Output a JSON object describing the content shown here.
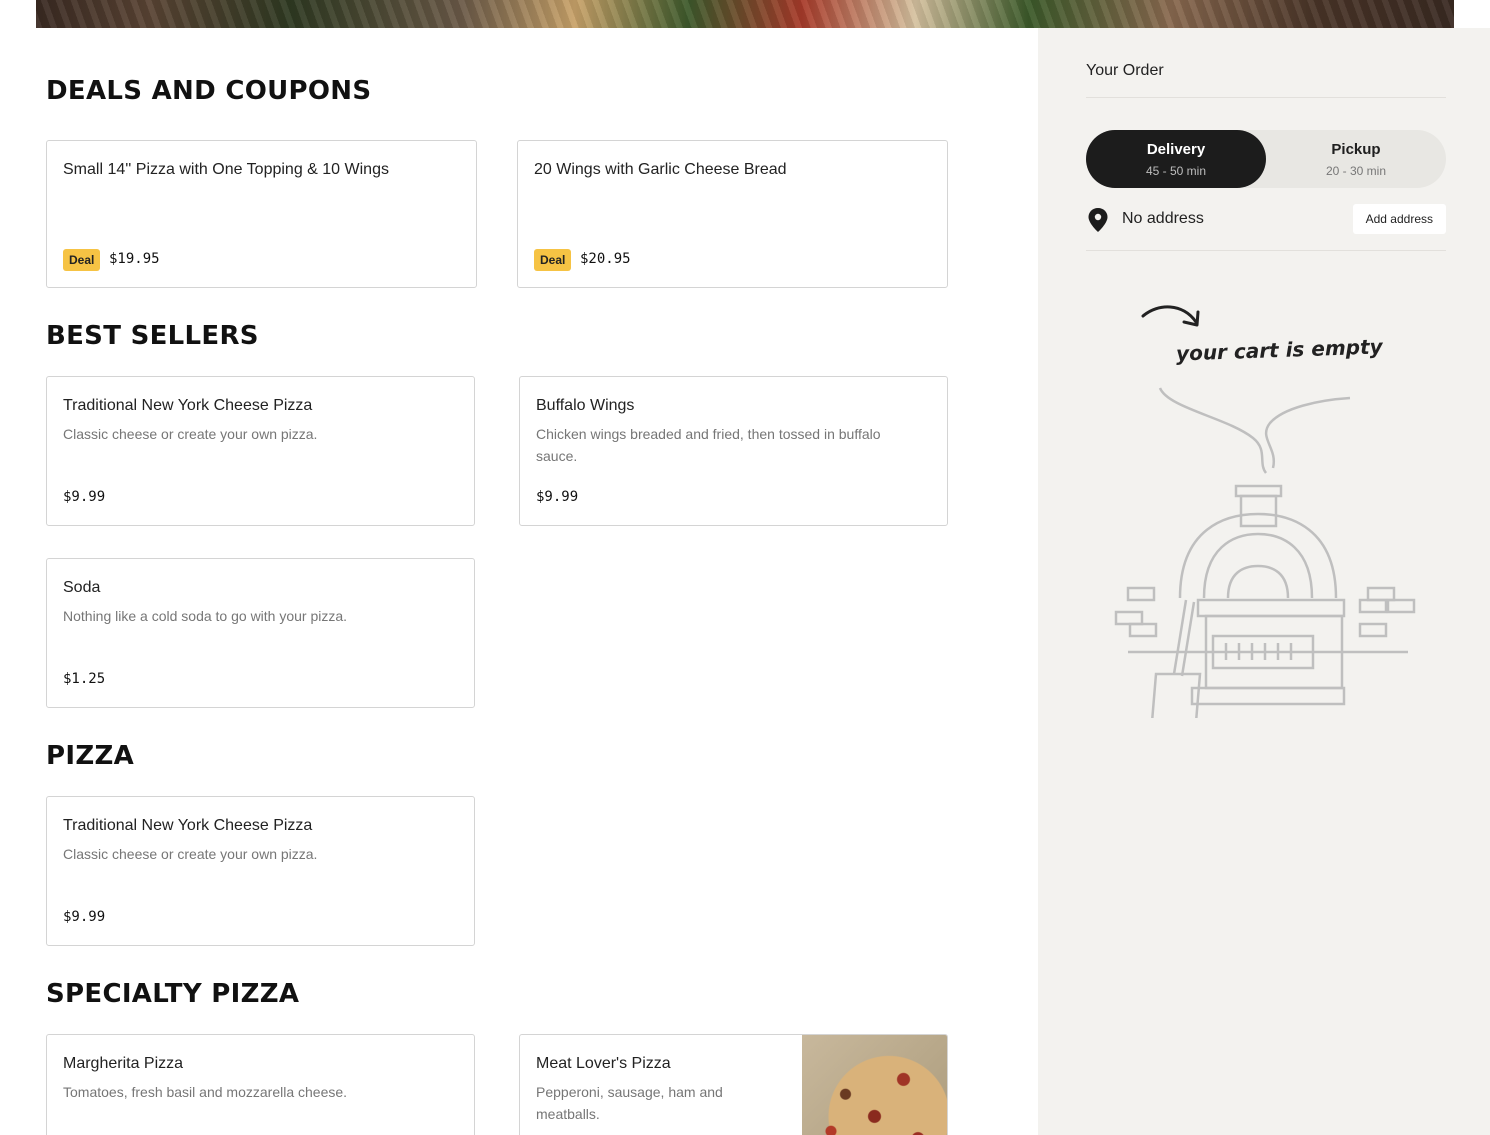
{
  "sections": {
    "deals": {
      "title": "DEALS AND COUPONS",
      "items": [
        {
          "name": "Small 14'' Pizza with One Topping & 10 Wings",
          "badge": "Deal",
          "price": "$19.95"
        },
        {
          "name": "20 Wings with Garlic Cheese Bread",
          "badge": "Deal",
          "price": "$20.95"
        }
      ]
    },
    "best_sellers": {
      "title": "BEST SELLERS",
      "items": [
        {
          "name": "Traditional New York Cheese Pizza",
          "desc": "Classic cheese or create your own pizza.",
          "price": "$9.99"
        },
        {
          "name": "Buffalo Wings",
          "desc": "Chicken wings breaded and fried, then tossed in buffalo sauce.",
          "price": "$9.99"
        },
        {
          "name": "Soda",
          "desc": "Nothing like a cold soda to go with your pizza.",
          "price": "$1.25"
        }
      ]
    },
    "pizza": {
      "title": "PIZZA",
      "items": [
        {
          "name": "Traditional New York Cheese Pizza",
          "desc": "Classic cheese or create your own pizza.",
          "price": "$9.99"
        }
      ]
    },
    "specialty": {
      "title": "SPECIALTY PIZZA",
      "items": [
        {
          "name": "Margherita Pizza",
          "desc": "Tomatoes, fresh basil and mozzarella cheese."
        },
        {
          "name": "Meat Lover's Pizza",
          "desc": "Pepperoni, sausage, ham and meatballs."
        }
      ]
    }
  },
  "order": {
    "title": "Your Order",
    "delivery": {
      "label": "Delivery",
      "time": "45 - 50 min",
      "active": true
    },
    "pickup": {
      "label": "Pickup",
      "time": "20 - 30 min",
      "active": false
    },
    "address": "No address",
    "add_address_label": "Add address",
    "empty_cart_text": "your cart is empty"
  },
  "colors": {
    "deal_badge": "#f6c344",
    "toggle_active": "#1c1c1c",
    "sidebar_bg": "#f3f2ef"
  },
  "icons": {
    "location": "map-pin-icon",
    "arrow": "curved-arrow-icon",
    "illustration": "pizza-oven-icon"
  }
}
